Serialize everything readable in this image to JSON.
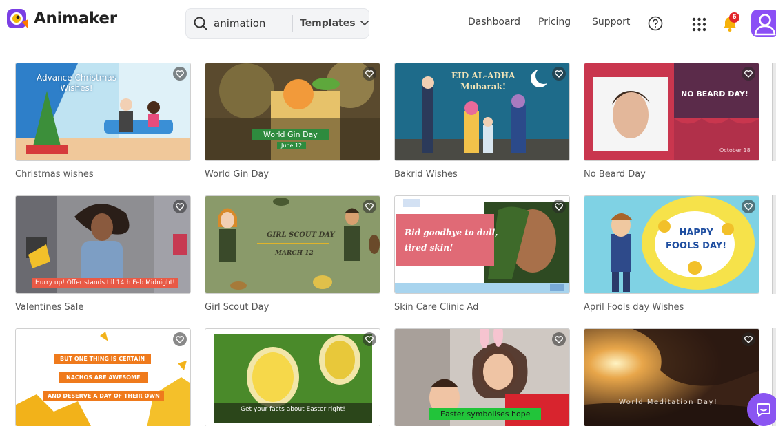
{
  "brand": {
    "name": "Animaker"
  },
  "search": {
    "value": "animation",
    "category": "Templates"
  },
  "nav": {
    "dashboard": "Dashboard",
    "pricing": "Pricing",
    "support": "Support"
  },
  "notifications": {
    "count": "6"
  },
  "colors": {
    "accent": "#8b4ff5",
    "badge": "#e2262b",
    "fav_bg": "#3a3a3a"
  },
  "templates": [
    {
      "title": "Christmas wishes",
      "overlay": [
        "Advance Christmas",
        "Wishes!"
      ]
    },
    {
      "title": "World Gin Day",
      "overlay": [
        "World Gin Day",
        "June 12"
      ]
    },
    {
      "title": "Bakrid Wishes",
      "overlay": [
        "EID AL-ADHA",
        "Mubarak!"
      ]
    },
    {
      "title": "No Beard Day",
      "overlay": [
        "NO BEARD DAY!",
        "October 18"
      ]
    },
    {
      "title": "Valentines Sale",
      "overlay": [
        "Hurry up! Offer stands till 14th Feb Midnight!"
      ]
    },
    {
      "title": "Girl Scout Day",
      "overlay": [
        "GIRL SCOUT DAY",
        "MARCH 12"
      ]
    },
    {
      "title": "Skin Care Clinic Ad",
      "overlay": [
        "Bid goodbye to dull,",
        "tired skin!"
      ]
    },
    {
      "title": "April Fools day Wishes",
      "overlay": [
        "HAPPY",
        "FOOLS DAY!"
      ]
    },
    {
      "title": "",
      "overlay": [
        "BUT ONE THING IS CERTAIN",
        "NACHOS ARE AWESOME",
        "AND DESERVE A DAY OF THEIR OWN"
      ]
    },
    {
      "title": "",
      "overlay": [
        "Get your facts about Easter right!"
      ]
    },
    {
      "title": "",
      "overlay": [
        "Easter symbolises hope"
      ]
    },
    {
      "title": "",
      "overlay": [
        "World Meditation Day!"
      ]
    }
  ]
}
